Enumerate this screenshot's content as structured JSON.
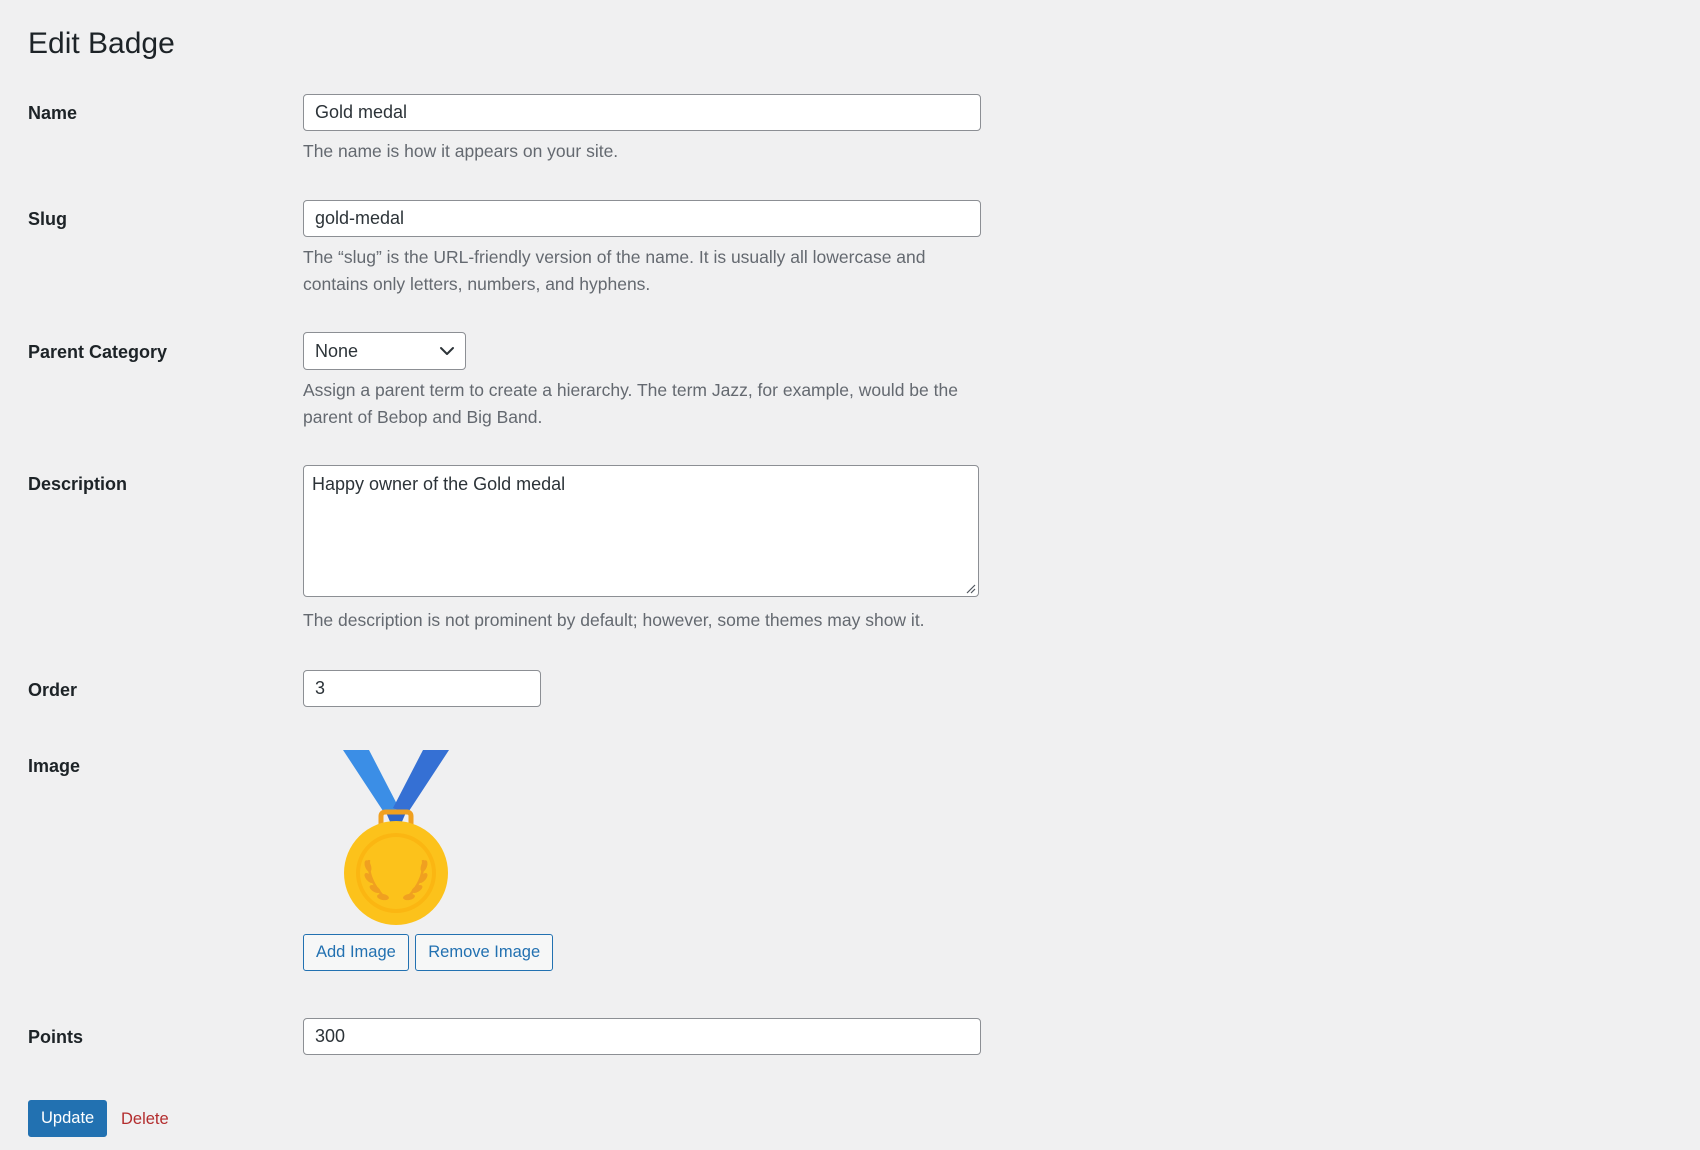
{
  "page": {
    "title": "Edit Badge"
  },
  "fields": {
    "name": {
      "label": "Name",
      "value": "Gold medal",
      "description": "The name is how it appears on your site."
    },
    "slug": {
      "label": "Slug",
      "value": "gold-medal",
      "description": "The “slug” is the URL-friendly version of the name. It is usually all lowercase and contains only letters, numbers, and hyphens."
    },
    "parent": {
      "label": "Parent Category",
      "selected": "None",
      "description": "Assign a parent term to create a hierarchy. The term Jazz, for example, would be the parent of Bebop and Big Band."
    },
    "description": {
      "label": "Description",
      "value": "Happy owner of the Gold medal",
      "description": "The description is not prominent by default; however, some themes may show it."
    },
    "order": {
      "label": "Order",
      "value": "3"
    },
    "image": {
      "label": "Image",
      "icon": "gold-medal-icon",
      "add_label": "Add Image",
      "remove_label": "Remove Image"
    },
    "points": {
      "label": "Points",
      "value": "300"
    }
  },
  "actions": {
    "update_label": "Update",
    "delete_label": "Delete"
  },
  "colors": {
    "background": "#f0f0f1",
    "accent": "#2271b1",
    "delete": "#b32d2e",
    "medal_gold": "#fcc21b",
    "ribbon_blue": "#3b8ee6"
  }
}
